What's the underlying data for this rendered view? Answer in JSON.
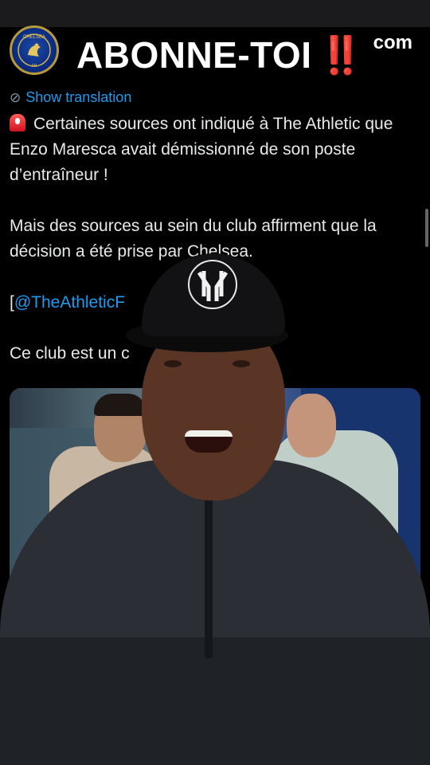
{
  "overlay": {
    "headline": "ABONNE-TOI",
    "headline_mark": "‼️",
    "corner_text": "com"
  },
  "tweet": {
    "show_translation": "Show translation",
    "line1": "Certaines sources ont indiqué à The Athletic que Enzo Maresca avait démissionné de son poste d’entraîneur !",
    "line2": "Mais des sources au sein du club affirment que la décision a été prise par Chelsea.",
    "mention_prefix": "[",
    "mention": "@TheAthleticF",
    "line4": "Ce club est un c"
  },
  "avatar": {
    "text_top": "CHELSEA",
    "text_bottom": "FR"
  },
  "colors": {
    "background": "#000000",
    "link": "#1d9bf0",
    "alert_red": "#e11d2a"
  },
  "icons": [
    "translate-icon",
    "siren-icon",
    "chelsea-crest-icon"
  ]
}
